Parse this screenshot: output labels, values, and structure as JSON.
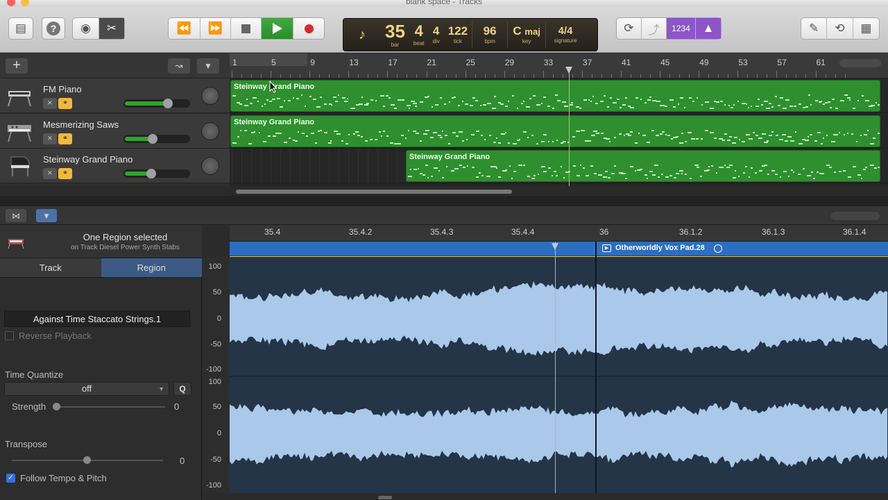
{
  "window": {
    "title": "blank space - Tracks"
  },
  "lcd": {
    "bar": "35",
    "bar_label": "bar",
    "beat": "4",
    "beat_label": "beat",
    "div": "4",
    "div_label": "div",
    "tick": "122",
    "tick_label": "tick",
    "bpm": "96",
    "bpm_label": "bpm",
    "key_note": "C",
    "key_mode": "maj",
    "key_label": "key",
    "signature": "4/4",
    "signature_label": "signature"
  },
  "toolbar": {
    "count_in": "1234"
  },
  "ruler": {
    "bars": [
      "1",
      "5",
      "9",
      "13",
      "17",
      "21",
      "25",
      "29",
      "33",
      "37",
      "41",
      "45",
      "49",
      "53",
      "57",
      "61"
    ]
  },
  "tracks": [
    {
      "name": "FM Piano",
      "volume": 0.7,
      "region_label": "Steinway Grand Piano"
    },
    {
      "name": "Mesmerizing Saws",
      "volume": 0.45,
      "region_label": "Steinway Grand Piano"
    },
    {
      "name": "Steinway Grand Piano",
      "volume": 0.43,
      "region_label": "Steinway Grand Piano"
    }
  ],
  "inspector": {
    "header_title": "One Region selected",
    "header_sub": "on Track Diesel Power Synth Stabs",
    "tabs": [
      "Track",
      "Region"
    ],
    "region_name": "Against Time Staccato Strings.1",
    "reverse_playback": "Reverse Playback",
    "time_quantize_label": "Time Quantize",
    "time_quantize_value": "off",
    "q_button": "Q",
    "strength_label": "Strength",
    "strength_value": "0",
    "transpose_label": "Transpose",
    "transpose_value": "0",
    "follow_label": "Follow Tempo & Pitch"
  },
  "editor": {
    "ruler": [
      "35.4",
      "35.4.2",
      "35.4.3",
      "35.4.4",
      "36",
      "36.1.2",
      "36.1.3",
      "36.1.4"
    ],
    "next_region": "Otherworldly Vox Pad.28",
    "y_labels_top": [
      "100",
      "50",
      "0",
      "-50",
      "-100"
    ],
    "y_labels_bottom": [
      "100",
      "50",
      "0",
      "-50",
      "-100"
    ]
  }
}
